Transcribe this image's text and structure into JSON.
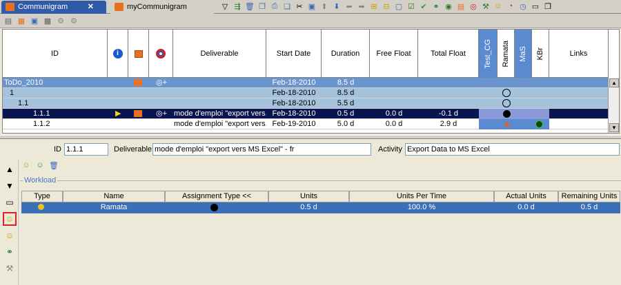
{
  "tabs": [
    {
      "label": "Communigram",
      "active": true
    },
    {
      "label": "myCommunigram",
      "active": false
    }
  ],
  "grid": {
    "columns": [
      "ID",
      "",
      "",
      "",
      "Deliverable",
      "Start Date",
      "Duration",
      "Free Float",
      "Total Float",
      "Test_CG",
      "Ramata",
      "MaS",
      "KBr",
      "Links"
    ],
    "rows": [
      {
        "id": "ToDo_2010",
        "deliverable": "",
        "start": "Feb-18-2010",
        "duration": "8.5 d",
        "free": "",
        "total": "",
        "style": "sel"
      },
      {
        "id": "1",
        "deliverable": "",
        "start": "Feb-18-2010",
        "duration": "8.5 d",
        "free": "",
        "total": "",
        "style": "group"
      },
      {
        "id": "1.1",
        "deliverable": "",
        "start": "Feb-18-2010",
        "duration": "5.5 d",
        "free": "",
        "total": "",
        "style": "group"
      },
      {
        "id": "1.1.1",
        "deliverable": "mode d'emploi \"export vers...",
        "start": "Feb-18-2010",
        "duration": "0.5 d",
        "free": "0.0 d",
        "total": "-0.1 d",
        "style": "dark"
      },
      {
        "id": "1.1.2",
        "deliverable": "mode d'emploi \"export vers...",
        "start": "Feb-19-2010",
        "duration": "5.0 d",
        "free": "0.0 d",
        "total": "2.9 d",
        "style": "white"
      }
    ]
  },
  "details": {
    "id_label": "ID",
    "id_value": "1.1.1",
    "deliverable_label": "Deliverable",
    "deliverable_value": "mode d'emploi \"export vers MS Excel\" - fr",
    "activity_label": "Activity",
    "activity_value": "Export Data to MS Excel"
  },
  "workload": {
    "title": "Workload",
    "headers": [
      "Type",
      "Name",
      "Assignment Type <<",
      "Units",
      "Units Per Time",
      "Actual Units",
      "Remaining Units"
    ],
    "rows": [
      {
        "name": "Ramata",
        "units": "0.5 d",
        "upt": "100.0 %",
        "actual": "0.0 d",
        "remaining": "0.5 d"
      }
    ]
  }
}
